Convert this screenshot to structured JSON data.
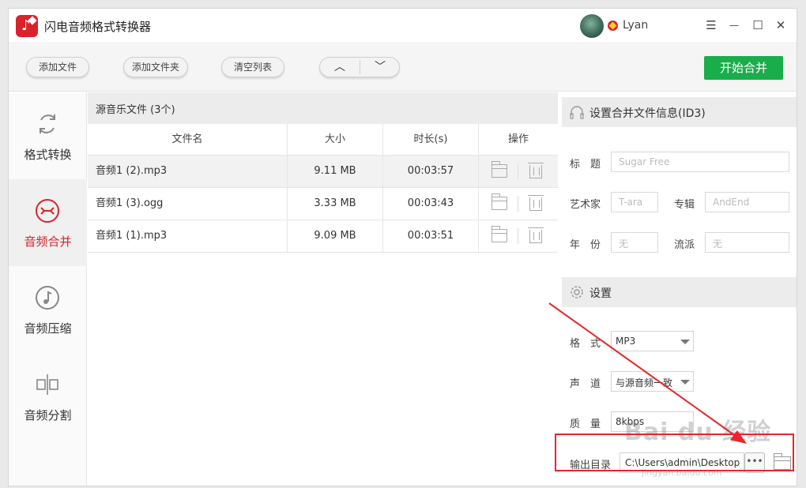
{
  "app": {
    "title": "闪电音频格式转换器",
    "username": "Lyan"
  },
  "window_controls": {
    "menu": "☰",
    "minimize": "—",
    "maximize": "☐",
    "close": "✕"
  },
  "toolbar": {
    "add_file": "添加文件",
    "add_folder": "添加文件夹",
    "clear_list": "清空列表",
    "move_up": "︿",
    "move_down": "﹀",
    "start_merge": "开始合并"
  },
  "sidebar": {
    "items": [
      {
        "label": "格式转换",
        "icon": "refresh-icon"
      },
      {
        "label": "音频合并",
        "icon": "merge-icon",
        "active": true
      },
      {
        "label": "音频压缩",
        "icon": "music-note-icon"
      },
      {
        "label": "音频分割",
        "icon": "split-icon"
      }
    ]
  },
  "file_list": {
    "title": "源音乐文件 (3个)",
    "columns": [
      "文件名",
      "大小",
      "时长(s)",
      "操作"
    ],
    "rows": [
      {
        "name": "音频1 (2).mp3",
        "size": "9.11 MB",
        "duration": "00:03:57"
      },
      {
        "name": "音频1 (3).ogg",
        "size": "3.33 MB",
        "duration": "00:03:43"
      },
      {
        "name": "音频1 (1).mp3",
        "size": "9.09 MB",
        "duration": "00:03:51"
      }
    ]
  },
  "id3": {
    "header": "设置合并文件信息(ID3)",
    "title_label": "标　题",
    "title_placeholder": "Sugar Free",
    "artist_label": "艺术家",
    "artist_placeholder": "T-ara",
    "album_label": "专辑",
    "album_placeholder": "AndEnd",
    "year_label": "年　份",
    "year_placeholder": "无",
    "genre_label": "流派",
    "genre_placeholder": "无"
  },
  "settings": {
    "header": "设置",
    "format_label": "格　式",
    "format_value": "MP3",
    "channel_label": "声　道",
    "channel_value": "与源音频一致",
    "quality_label": "质　量",
    "quality_value": "8kbps",
    "output_label": "输出目录",
    "output_path": "C:\\Users\\admin\\Desktop",
    "browse": "•••"
  },
  "watermark": {
    "text": "Bai du 经验",
    "sub": "jingyan.baidu.com"
  },
  "colors": {
    "accent_red": "#d8232a",
    "start_green": "#1aad4b",
    "annotation_red": "#e8262a"
  }
}
